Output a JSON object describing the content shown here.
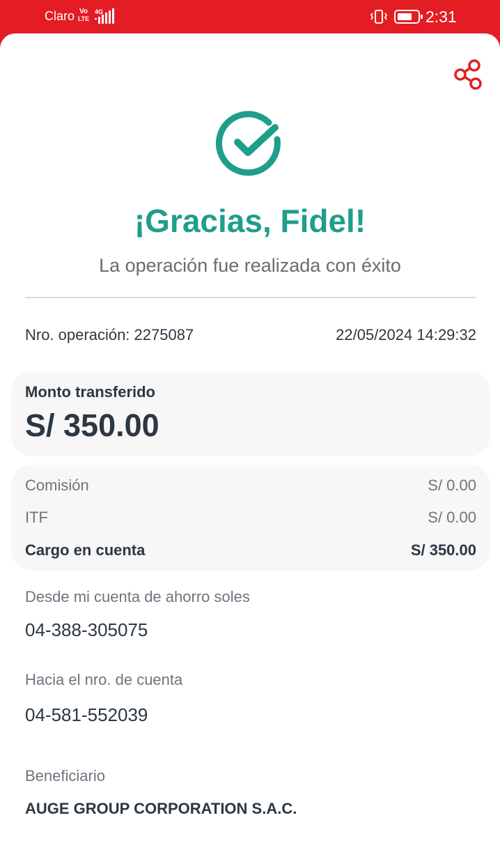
{
  "status_bar": {
    "carrier": "Claro",
    "volte_top": "Vo",
    "volte_bottom": "LTE",
    "network": "4G",
    "time": "2:31"
  },
  "header": {
    "share_icon": "share-icon",
    "success_icon": "check-circle-icon"
  },
  "confirmation": {
    "title": "¡Gracias, Fidel!",
    "subtitle": "La operación fue realizada con éxito"
  },
  "operation": {
    "number_text": "Nro. operación: 2275087",
    "datetime": "22/05/2024 14:29:32"
  },
  "amount": {
    "label": "Monto transferido",
    "value": "S/ 350.00"
  },
  "charges": [
    {
      "label": "Comisión",
      "value": "S/ 0.00"
    },
    {
      "label": "ITF",
      "value": "S/ 0.00"
    },
    {
      "label": "Cargo en cuenta",
      "value": "S/ 350.00"
    }
  ],
  "from_account": {
    "label": "Desde mi cuenta de ahorro soles",
    "value": "04-388-305075"
  },
  "to_account": {
    "label": "Hacia el nro. de cuenta",
    "value": "04-581-552039"
  },
  "beneficiary": {
    "label": "Beneficiario",
    "value": "AUGE GROUP CORPORATION S.A.C."
  },
  "colors": {
    "brand_red": "#e41d24",
    "success_teal": "#1f9e8c",
    "text_dark": "#2c3743",
    "text_muted": "#6c757d",
    "card_bg": "#f7f7f7"
  }
}
